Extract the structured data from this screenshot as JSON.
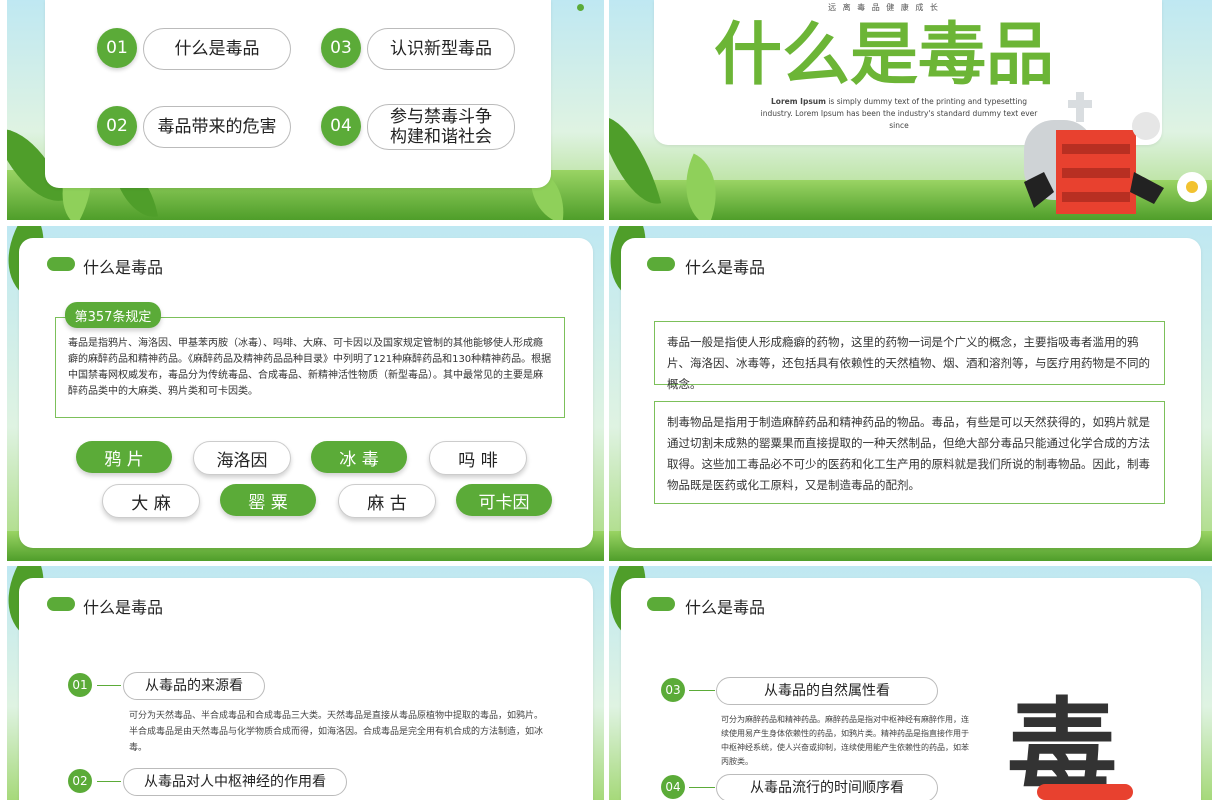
{
  "slide1": {
    "items": [
      {
        "num": "01",
        "label": "什么是毒品"
      },
      {
        "num": "02",
        "label": "毒品带来的危害"
      },
      {
        "num": "03",
        "label": "认识新型毒品"
      },
      {
        "num": "04",
        "label_line1": "参与禁毒斗争",
        "label_line2": "构建和谐社会"
      }
    ]
  },
  "slide2": {
    "subtitle": "远 离 毒 品 健 康 成 长",
    "title": "什么是毒品",
    "lorem_bold": "Lorem Ipsum",
    "lorem_rest": " is simply dummy text of the printing and typesetting industry. Lorem Ipsum has been the industry's standard dummy text ever since"
  },
  "slide3": {
    "header": "什么是毒品",
    "badge": "第357条规定",
    "body": "毒品是指鸦片、海洛因、甲基苯丙胺（冰毒）、吗啡、大麻、可卡因以及国家规定管制的其他能够使人形成瘾癖的麻醉药品和精神药品。《麻醉药品及精神药品品种目录》中列明了121种麻醉药品和130种精神药品。根据中国禁毒网权威发布，毒品分为传统毒品、合成毒品、新精神活性物质（新型毒品）。其中最常见的主要是麻醉药品类中的大麻类、鸦片类和可卡因类。",
    "tags_row1": [
      "鸦 片",
      "海洛因",
      "冰 毒",
      "吗 啡"
    ],
    "tags_row2": [
      "大 麻",
      "罂 粟",
      "麻 古",
      "可卡因"
    ]
  },
  "slide4": {
    "header": "什么是毒品",
    "box1": "毒品一般是指使人形成瘾癖的药物，这里的药物一词是个广义的概念，主要指吸毒者滥用的鸦片、海洛因、冰毒等，还包括具有依赖性的天然植物、烟、酒和溶剂等，与医疗用药物是不同的概念。",
    "box2": "制毒物品是指用于制造麻醉药品和精神药品的物品。毒品，有些是可以天然获得的，如鸦片就是通过切割未成熟的罂粟果而直接提取的一种天然制品，但绝大部分毒品只能通过化学合成的方法取得。这些加工毒品必不可少的医药和化工生产用的原料就是我们所说的制毒物品。因此，制毒物品既是医药或化工原料，又是制造毒品的配剂。"
  },
  "slide5": {
    "header": "什么是毒品",
    "item1_num": "01",
    "item1_label": "从毒品的来源看",
    "item1_text": "可分为天然毒品、半合成毒品和合成毒品三大类。天然毒品是直接从毒品原植物中提取的毒品，如鸦片。半合成毒品是由天然毒品与化学物质合成而得，如海洛因。合成毒品是完全用有机合成的方法制造，如冰毒。",
    "item2_num": "02",
    "item2_label": "从毒品对人中枢神经的作用看"
  },
  "slide6": {
    "header": "什么是毒品",
    "item3_num": "03",
    "item3_label": "从毒品的自然属性看",
    "item3_text": "可分为麻醉药品和精神药品。麻醉药品是指对中枢神经有麻醉作用，连续使用易产生身体依赖性的药品，如鸦片类。精神药品是指直接作用于中枢神经系统，使人兴奋或抑制，连续使用能产生依赖性的药品，如苯丙胺类。",
    "item4_num": "04",
    "item4_label": "从毒品流行的时间顺序看",
    "big_char": "毒"
  },
  "colors": {
    "accent": "#5bab38",
    "title_green": "#6cb536",
    "danger": "#e8412f"
  }
}
